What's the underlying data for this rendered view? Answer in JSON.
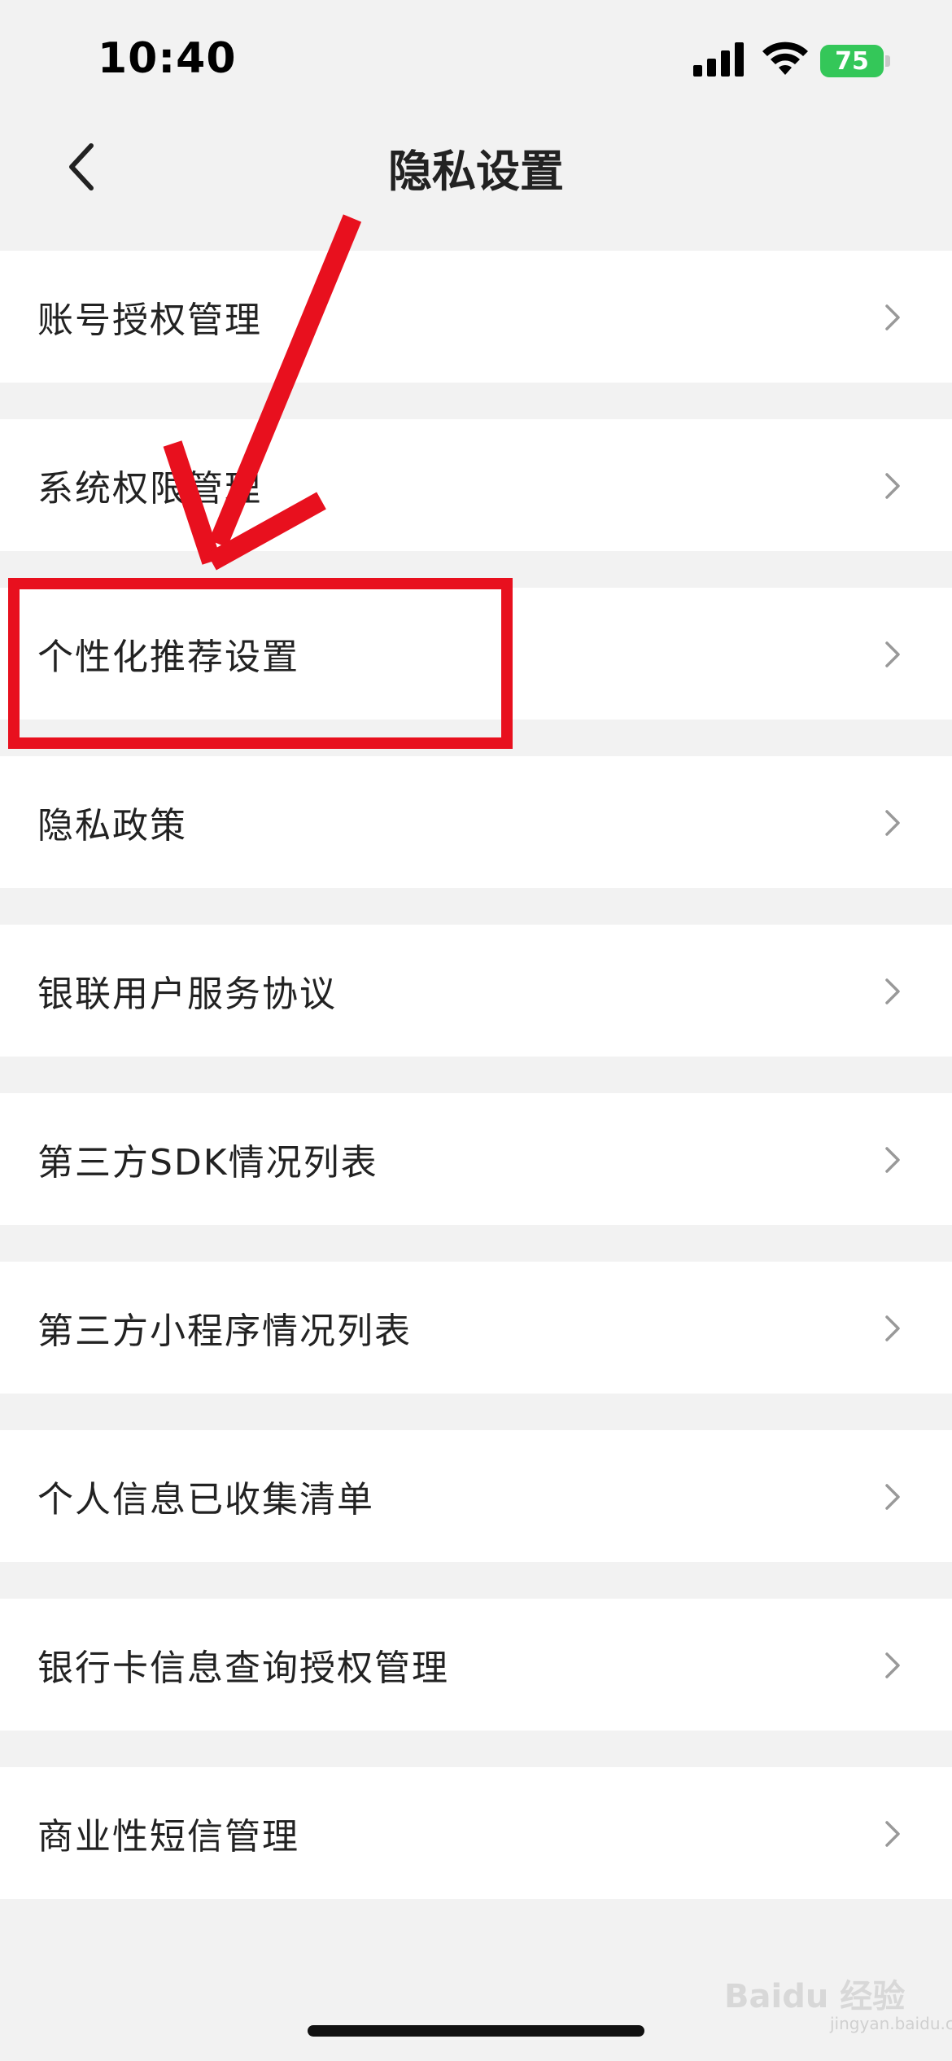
{
  "status_bar": {
    "time": "10:40",
    "battery": "75",
    "icons": [
      "signal-icon",
      "wifi-icon",
      "battery-icon"
    ]
  },
  "nav": {
    "title": "隐私设置",
    "back_icon": "chevron-left-icon"
  },
  "items": [
    {
      "label": "账号授权管理"
    },
    {
      "label": "系统权限管理"
    },
    {
      "label": "个性化推荐设置"
    },
    {
      "label": "隐私政策"
    },
    {
      "label": "银联用户服务协议"
    },
    {
      "label": "第三方SDK情况列表"
    },
    {
      "label": "第三方小程序情况列表"
    },
    {
      "label": "个人信息已收集清单"
    },
    {
      "label": "银行卡信息查询授权管理"
    },
    {
      "label": "商业性短信管理"
    }
  ],
  "watermark": {
    "main": "Baidu 经验",
    "sub": "jingyan.baidu.com"
  },
  "colors": {
    "background": "#f2f2f2",
    "row": "#ffffff",
    "annotation": "#e8101e",
    "battery": "#34c759"
  }
}
